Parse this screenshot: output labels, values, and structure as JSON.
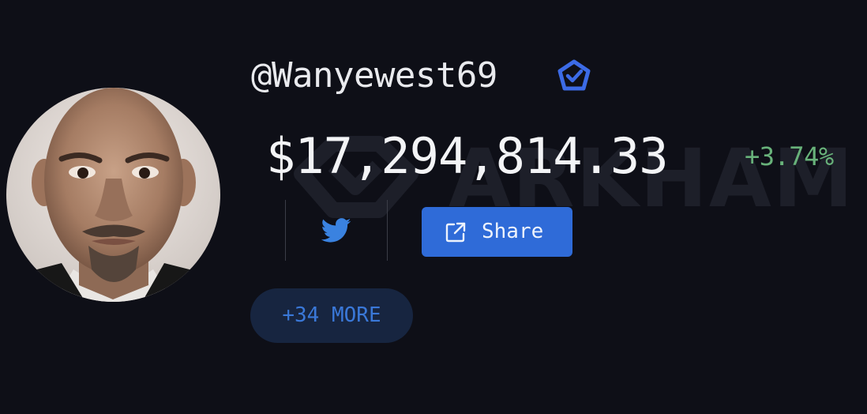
{
  "profile": {
    "handle": "@Wanyewest69",
    "verified_icon": "verified-badge-icon",
    "avatar": "profile-photo"
  },
  "portfolio": {
    "balance": "$17,294,814.33",
    "change": "+3.74%",
    "change_color": "#68b27a"
  },
  "watermark": {
    "text": "ARKHAM"
  },
  "social": {
    "twitter_icon": "twitter-icon"
  },
  "actions": {
    "share_label": "Share",
    "share_icon": "external-link-icon",
    "more_label": "+34 MORE"
  },
  "colors": {
    "background": "#0e0f17",
    "accent": "#2f6bd8",
    "twitter": "#3a82e0",
    "badge": "#3c6be6"
  }
}
